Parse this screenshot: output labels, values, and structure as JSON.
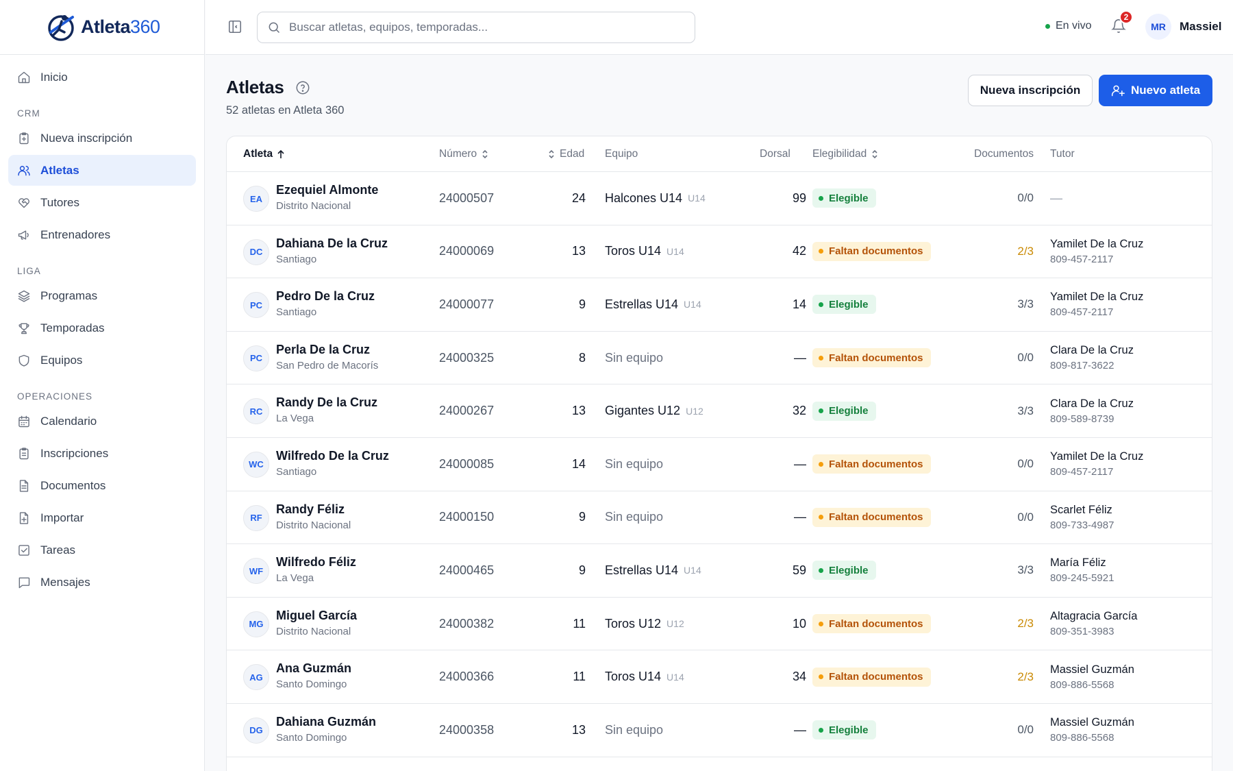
{
  "brand": {
    "name": "Atleta",
    "num": "360"
  },
  "sidebar": {
    "top": [
      {
        "label": "Inicio",
        "icon": "home-icon"
      }
    ],
    "sections": [
      {
        "title": "CRM",
        "items": [
          {
            "label": "Nueva inscripción",
            "icon": "clipboard-plus-icon"
          },
          {
            "label": "Atletas",
            "icon": "users-icon",
            "active": true
          },
          {
            "label": "Tutores",
            "icon": "heart-handshake-icon"
          },
          {
            "label": "Entrenadores",
            "icon": "megaphone-icon"
          }
        ]
      },
      {
        "title": "LIGA",
        "items": [
          {
            "label": "Programas",
            "icon": "layers-icon"
          },
          {
            "label": "Temporadas",
            "icon": "trophy-icon"
          },
          {
            "label": "Equipos",
            "icon": "shield-icon"
          }
        ]
      },
      {
        "title": "OPERACIONES",
        "items": [
          {
            "label": "Calendario",
            "icon": "calendar-icon"
          },
          {
            "label": "Inscripciones",
            "icon": "clipboard-icon"
          },
          {
            "label": "Documentos",
            "icon": "file-icon"
          },
          {
            "label": "Importar",
            "icon": "file-import-icon"
          },
          {
            "label": "Tareas",
            "icon": "checkbox-icon"
          },
          {
            "label": "Mensajes",
            "icon": "message-icon"
          }
        ]
      }
    ]
  },
  "header": {
    "search_placeholder": "Buscar atletas, equipos, temporadas...",
    "live_label": "En vivo",
    "notifications_count": "2",
    "user_initials": "MR",
    "user_name": "Massiel"
  },
  "page": {
    "title": "Atletas",
    "subtitle": "52 atletas en Atleta 360",
    "btn_secondary": "Nueva inscripción",
    "btn_primary": "Nuevo atleta"
  },
  "table": {
    "columns": {
      "atleta": "Atleta",
      "numero": "Número",
      "edad": "Edad",
      "equipo": "Equipo",
      "dorsal": "Dorsal",
      "elegibilidad": "Elegibilidad",
      "documentos": "Documentos",
      "tutor": "Tutor"
    },
    "rows": [
      {
        "initials": "EA",
        "name": "Ezequiel Almonte",
        "city": "Distrito Nacional",
        "numero": "24000507",
        "edad": "24",
        "team": "Halcones U14",
        "tag": "U14",
        "dorsal": "99",
        "status": "Elegible",
        "status_type": "ok",
        "docs": "0/0",
        "docs_partial": false,
        "tutor": "—",
        "phone": ""
      },
      {
        "initials": "DC",
        "name": "Dahiana De la Cruz",
        "city": "Santiago",
        "numero": "24000069",
        "edad": "13",
        "team": "Toros U14",
        "tag": "U14",
        "dorsal": "42",
        "status": "Faltan documentos",
        "status_type": "warn",
        "docs": "2/3",
        "docs_partial": true,
        "tutor": "Yamilet De la Cruz",
        "phone": "809-457-2117"
      },
      {
        "initials": "PC",
        "name": "Pedro De la Cruz",
        "city": "Santiago",
        "numero": "24000077",
        "edad": "9",
        "team": "Estrellas U14",
        "tag": "U14",
        "dorsal": "14",
        "status": "Elegible",
        "status_type": "ok",
        "docs": "3/3",
        "docs_partial": false,
        "tutor": "Yamilet De la Cruz",
        "phone": "809-457-2117"
      },
      {
        "initials": "PC",
        "name": "Perla De la Cruz",
        "city": "San Pedro de Macorís",
        "numero": "24000325",
        "edad": "8",
        "team": "Sin equipo",
        "tag": "",
        "dorsal": "—",
        "status": "Faltan documentos",
        "status_type": "warn",
        "docs": "0/0",
        "docs_partial": false,
        "tutor": "Clara De la Cruz",
        "phone": "809-817-3622"
      },
      {
        "initials": "RC",
        "name": "Randy De la Cruz",
        "city": "La Vega",
        "numero": "24000267",
        "edad": "13",
        "team": "Gigantes U12",
        "tag": "U12",
        "dorsal": "32",
        "status": "Elegible",
        "status_type": "ok",
        "docs": "3/3",
        "docs_partial": false,
        "tutor": "Clara De la Cruz",
        "phone": "809-589-8739"
      },
      {
        "initials": "WC",
        "name": "Wilfredo De la Cruz",
        "city": "Santiago",
        "numero": "24000085",
        "edad": "14",
        "team": "Sin equipo",
        "tag": "",
        "dorsal": "—",
        "status": "Faltan documentos",
        "status_type": "warn",
        "docs": "0/0",
        "docs_partial": false,
        "tutor": "Yamilet De la Cruz",
        "phone": "809-457-2117"
      },
      {
        "initials": "RF",
        "name": "Randy Féliz",
        "city": "Distrito Nacional",
        "numero": "24000150",
        "edad": "9",
        "team": "Sin equipo",
        "tag": "",
        "dorsal": "—",
        "status": "Faltan documentos",
        "status_type": "warn",
        "docs": "0/0",
        "docs_partial": false,
        "tutor": "Scarlet Féliz",
        "phone": "809-733-4987"
      },
      {
        "initials": "WF",
        "name": "Wilfredo Féliz",
        "city": "La Vega",
        "numero": "24000465",
        "edad": "9",
        "team": "Estrellas U14",
        "tag": "U14",
        "dorsal": "59",
        "status": "Elegible",
        "status_type": "ok",
        "docs": "3/3",
        "docs_partial": false,
        "tutor": "María Féliz",
        "phone": "809-245-5921"
      },
      {
        "initials": "MG",
        "name": "Miguel García",
        "city": "Distrito Nacional",
        "numero": "24000382",
        "edad": "11",
        "team": "Toros U12",
        "tag": "U12",
        "dorsal": "10",
        "status": "Faltan documentos",
        "status_type": "warn",
        "docs": "2/3",
        "docs_partial": true,
        "tutor": "Altagracia García",
        "phone": "809-351-3983"
      },
      {
        "initials": "AG",
        "name": "Ana Guzmán",
        "city": "Santo Domingo",
        "numero": "24000366",
        "edad": "11",
        "team": "Toros U14",
        "tag": "U14",
        "dorsal": "34",
        "status": "Faltan documentos",
        "status_type": "warn",
        "docs": "2/3",
        "docs_partial": true,
        "tutor": "Massiel Guzmán",
        "phone": "809-886-5568"
      },
      {
        "initials": "DG",
        "name": "Dahiana Guzmán",
        "city": "Santo Domingo",
        "numero": "24000358",
        "edad": "13",
        "team": "Sin equipo",
        "tag": "",
        "dorsal": "—",
        "status": "Elegible",
        "status_type": "ok",
        "docs": "0/0",
        "docs_partial": false,
        "tutor": "Massiel Guzmán",
        "phone": "809-886-5568"
      }
    ]
  }
}
